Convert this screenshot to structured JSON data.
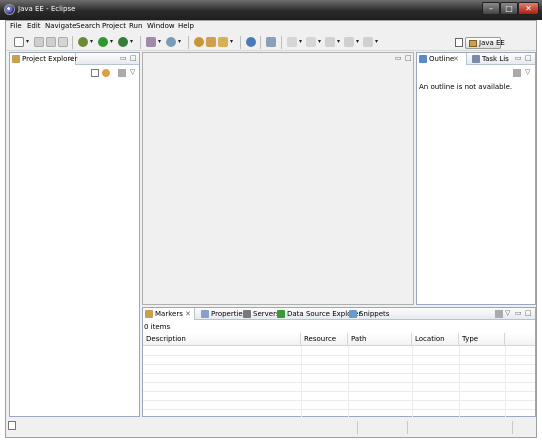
{
  "window": {
    "title": "Java EE - Eclipse",
    "minimize_icon": "minimize-icon",
    "maximize_icon": "maximize-icon",
    "close_icon": "close-icon"
  },
  "menu": [
    "File",
    "Edit",
    "Navigate",
    "Search",
    "Project",
    "Run",
    "Window",
    "Help"
  ],
  "toolbar": {
    "perspective_label": "Java EE",
    "icons": [
      "new-icon",
      "save-icon",
      "save-all-icon",
      "print-icon",
      "debug-icon",
      "run-icon",
      "run-external-icon",
      "new-java-project-icon",
      "new-package-icon",
      "open-type-icon",
      "open-task-icon",
      "search-icon",
      "web-browser-icon",
      "next-annotation-icon",
      "prev-annotation-icon",
      "back-icon",
      "forward-icon",
      "open-perspective-icon"
    ]
  },
  "project_explorer": {
    "tab_label": "Project Explorer",
    "close_glyph": "✕",
    "collapse_all_icon": "collapse-all-icon",
    "link_editor_icon": "link-with-editor-icon",
    "view_menu_icon": "view-menu-icon"
  },
  "outline": {
    "tabs": [
      {
        "label": "Outline",
        "icon": "outline-icon"
      },
      {
        "label": "Task Lis",
        "icon": "task-list-icon"
      }
    ],
    "message": "An outline is not available."
  },
  "markers": {
    "tabs": [
      {
        "label": "Markers",
        "icon": "markers-icon"
      },
      {
        "label": "Properties",
        "icon": "properties-icon"
      },
      {
        "label": "Servers",
        "icon": "servers-icon"
      },
      {
        "label": "Data Source Explorer",
        "icon": "data-source-explorer-icon"
      },
      {
        "label": "Snippets",
        "icon": "snippets-icon"
      }
    ],
    "count": "0 items",
    "columns": [
      "Description",
      "Resource",
      "Path",
      "Location",
      "Type"
    ]
  },
  "panel_controls": {
    "minimize": "▭",
    "maximize": "□",
    "close": "✕",
    "menu": "▽"
  },
  "colors": {
    "titlebar": "#2a2a2a",
    "accent": "#99a8bc"
  }
}
